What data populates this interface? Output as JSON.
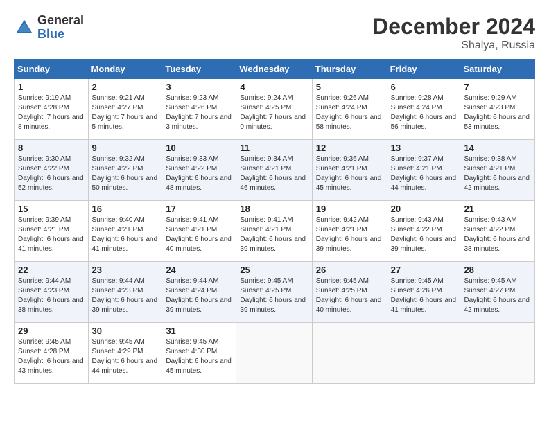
{
  "logo": {
    "general": "General",
    "blue": "Blue"
  },
  "header": {
    "month": "December 2024",
    "location": "Shalya, Russia"
  },
  "weekdays": [
    "Sunday",
    "Monday",
    "Tuesday",
    "Wednesday",
    "Thursday",
    "Friday",
    "Saturday"
  ],
  "weeks": [
    [
      {
        "day": "1",
        "sunrise": "9:19 AM",
        "sunset": "4:28 PM",
        "daylight": "7 hours and 8 minutes."
      },
      {
        "day": "2",
        "sunrise": "9:21 AM",
        "sunset": "4:27 PM",
        "daylight": "7 hours and 5 minutes."
      },
      {
        "day": "3",
        "sunrise": "9:23 AM",
        "sunset": "4:26 PM",
        "daylight": "7 hours and 3 minutes."
      },
      {
        "day": "4",
        "sunrise": "9:24 AM",
        "sunset": "4:25 PM",
        "daylight": "7 hours and 0 minutes."
      },
      {
        "day": "5",
        "sunrise": "9:26 AM",
        "sunset": "4:24 PM",
        "daylight": "6 hours and 58 minutes."
      },
      {
        "day": "6",
        "sunrise": "9:28 AM",
        "sunset": "4:24 PM",
        "daylight": "6 hours and 56 minutes."
      },
      {
        "day": "7",
        "sunrise": "9:29 AM",
        "sunset": "4:23 PM",
        "daylight": "6 hours and 53 minutes."
      }
    ],
    [
      {
        "day": "8",
        "sunrise": "9:30 AM",
        "sunset": "4:22 PM",
        "daylight": "6 hours and 52 minutes."
      },
      {
        "day": "9",
        "sunrise": "9:32 AM",
        "sunset": "4:22 PM",
        "daylight": "6 hours and 50 minutes."
      },
      {
        "day": "10",
        "sunrise": "9:33 AM",
        "sunset": "4:22 PM",
        "daylight": "6 hours and 48 minutes."
      },
      {
        "day": "11",
        "sunrise": "9:34 AM",
        "sunset": "4:21 PM",
        "daylight": "6 hours and 46 minutes."
      },
      {
        "day": "12",
        "sunrise": "9:36 AM",
        "sunset": "4:21 PM",
        "daylight": "6 hours and 45 minutes."
      },
      {
        "day": "13",
        "sunrise": "9:37 AM",
        "sunset": "4:21 PM",
        "daylight": "6 hours and 44 minutes."
      },
      {
        "day": "14",
        "sunrise": "9:38 AM",
        "sunset": "4:21 PM",
        "daylight": "6 hours and 42 minutes."
      }
    ],
    [
      {
        "day": "15",
        "sunrise": "9:39 AM",
        "sunset": "4:21 PM",
        "daylight": "6 hours and 41 minutes."
      },
      {
        "day": "16",
        "sunrise": "9:40 AM",
        "sunset": "4:21 PM",
        "daylight": "6 hours and 41 minutes."
      },
      {
        "day": "17",
        "sunrise": "9:41 AM",
        "sunset": "4:21 PM",
        "daylight": "6 hours and 40 minutes."
      },
      {
        "day": "18",
        "sunrise": "9:41 AM",
        "sunset": "4:21 PM",
        "daylight": "6 hours and 39 minutes."
      },
      {
        "day": "19",
        "sunrise": "9:42 AM",
        "sunset": "4:21 PM",
        "daylight": "6 hours and 39 minutes."
      },
      {
        "day": "20",
        "sunrise": "9:43 AM",
        "sunset": "4:22 PM",
        "daylight": "6 hours and 39 minutes."
      },
      {
        "day": "21",
        "sunrise": "9:43 AM",
        "sunset": "4:22 PM",
        "daylight": "6 hours and 38 minutes."
      }
    ],
    [
      {
        "day": "22",
        "sunrise": "9:44 AM",
        "sunset": "4:23 PM",
        "daylight": "6 hours and 38 minutes."
      },
      {
        "day": "23",
        "sunrise": "9:44 AM",
        "sunset": "4:23 PM",
        "daylight": "6 hours and 39 minutes."
      },
      {
        "day": "24",
        "sunrise": "9:44 AM",
        "sunset": "4:24 PM",
        "daylight": "6 hours and 39 minutes."
      },
      {
        "day": "25",
        "sunrise": "9:45 AM",
        "sunset": "4:25 PM",
        "daylight": "6 hours and 39 minutes."
      },
      {
        "day": "26",
        "sunrise": "9:45 AM",
        "sunset": "4:25 PM",
        "daylight": "6 hours and 40 minutes."
      },
      {
        "day": "27",
        "sunrise": "9:45 AM",
        "sunset": "4:26 PM",
        "daylight": "6 hours and 41 minutes."
      },
      {
        "day": "28",
        "sunrise": "9:45 AM",
        "sunset": "4:27 PM",
        "daylight": "6 hours and 42 minutes."
      }
    ],
    [
      {
        "day": "29",
        "sunrise": "9:45 AM",
        "sunset": "4:28 PM",
        "daylight": "6 hours and 43 minutes."
      },
      {
        "day": "30",
        "sunrise": "9:45 AM",
        "sunset": "4:29 PM",
        "daylight": "6 hours and 44 minutes."
      },
      {
        "day": "31",
        "sunrise": "9:45 AM",
        "sunset": "4:30 PM",
        "daylight": "6 hours and 45 minutes."
      },
      null,
      null,
      null,
      null
    ]
  ],
  "labels": {
    "sunrise": "Sunrise:",
    "sunset": "Sunset:",
    "daylight": "Daylight:"
  }
}
